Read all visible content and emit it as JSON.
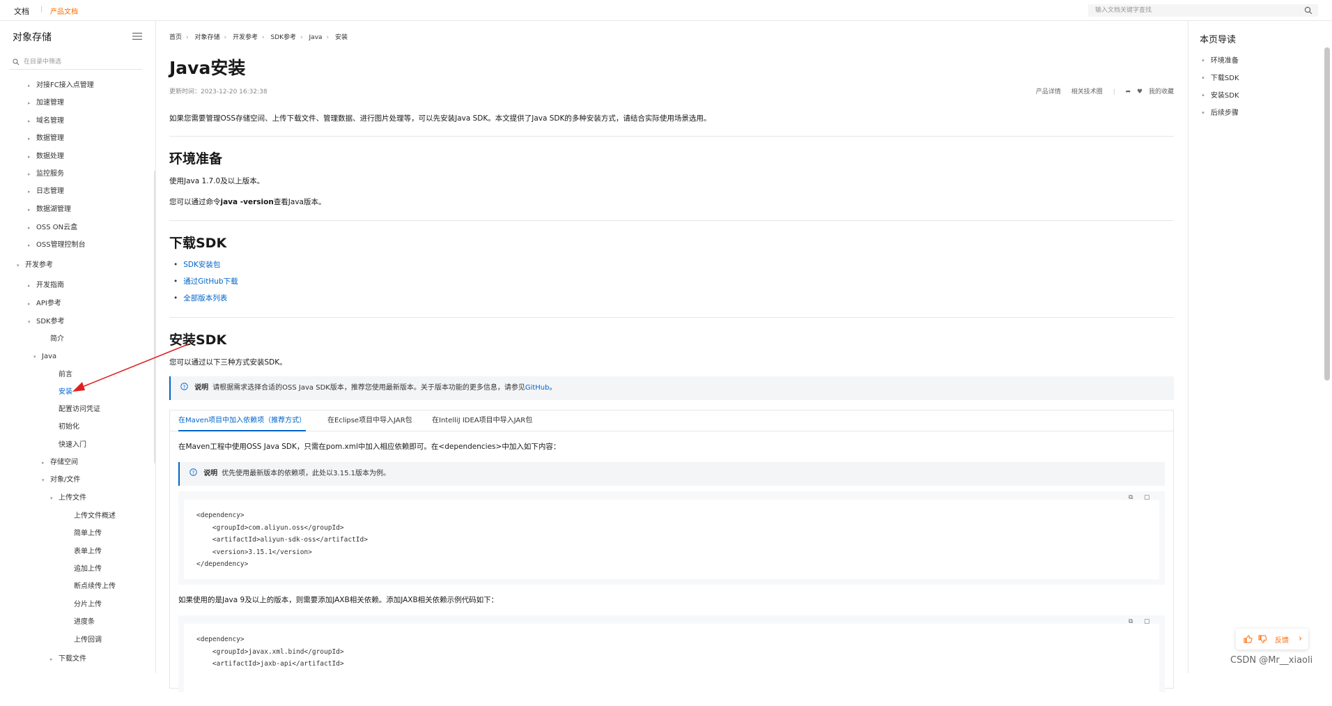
{
  "topbar": {
    "doc_label": "文档",
    "product_label": "产品文档",
    "search_placeholder": "输入文档关键字查找"
  },
  "sidebar": {
    "title": "对象存储",
    "filter_placeholder": "在目录中筛选",
    "items": [
      {
        "label": "对接FC接入点管理",
        "caret": "▸"
      },
      {
        "label": "加速管理",
        "caret": "▸"
      },
      {
        "label": "域名管理",
        "caret": "▸"
      },
      {
        "label": "数据管理",
        "caret": "▸"
      },
      {
        "label": "数据处理",
        "caret": "▸"
      },
      {
        "label": "监控服务",
        "caret": "▸"
      },
      {
        "label": "日志管理",
        "caret": "▸"
      },
      {
        "label": "数据湖管理",
        "caret": "▸"
      },
      {
        "label": "OSS ON云盒",
        "caret": "▸"
      },
      {
        "label": "OSS管理控制台",
        "caret": "▸"
      },
      {
        "label": "开发参考",
        "caret": "▾"
      },
      {
        "label": "开发指南",
        "caret": "▸"
      },
      {
        "label": "API参考",
        "caret": "▸"
      },
      {
        "label": "SDK参考",
        "caret": "▾"
      },
      {
        "label": "简介",
        "caret": ""
      },
      {
        "label": "Java",
        "caret": "▾"
      },
      {
        "label": "前言",
        "caret": ""
      },
      {
        "label": "安装",
        "caret": ""
      },
      {
        "label": "配置访问凭证",
        "caret": ""
      },
      {
        "label": "初始化",
        "caret": ""
      },
      {
        "label": "快速入门",
        "caret": ""
      },
      {
        "label": "存储空间",
        "caret": "▸"
      },
      {
        "label": "对象/文件",
        "caret": "▾"
      },
      {
        "label": "上传文件",
        "caret": "▾"
      },
      {
        "label": "上传文件概述",
        "caret": ""
      },
      {
        "label": "简单上传",
        "caret": ""
      },
      {
        "label": "表单上传",
        "caret": ""
      },
      {
        "label": "追加上传",
        "caret": ""
      },
      {
        "label": "断点续传上传",
        "caret": ""
      },
      {
        "label": "分片上传",
        "caret": ""
      },
      {
        "label": "进度条",
        "caret": ""
      },
      {
        "label": "上传回调",
        "caret": ""
      },
      {
        "label": "下载文件",
        "caret": "▸"
      }
    ]
  },
  "breadcrumb": [
    "首页",
    "对象存储",
    "开发参考",
    "SDK参考",
    "Java",
    "安装"
  ],
  "article": {
    "title": "Java安装",
    "updated": "更新时间：2023-12-20 16:32:38",
    "actions": [
      "产品详情",
      "相关技术圈",
      "我的收藏"
    ],
    "intro": "如果您需要管理OSS存储空间、上传下载文件、管理数据、进行图片处理等，可以先安装Java SDK。本文提供了Java SDK的多种安装方式，请结合实际使用场景选用。",
    "env_title": "环境准备",
    "env_p1": "使用Java 1.7.0及以上版本。",
    "env_p2_a": "您可以通过命令",
    "env_p2_b": "java -version",
    "env_p2_c": "查看Java版本。",
    "download_title": "下载SDK",
    "download_links": [
      "SDK安装包",
      "通过GitHub下载",
      "全部版本列表"
    ],
    "install_title": "安装SDK",
    "install_p": "您可以通过以下三种方式安装SDK。",
    "note1_label": "说明",
    "note1_text": "请根据需求选择合适的OSS Java SDK版本，推荐您使用最新版本。关于版本功能的更多信息，请参见",
    "note1_link": "GitHub",
    "note1_end": "。",
    "tabs": [
      "在Maven项目中加入依赖项（推荐方式）",
      "在Eclipse项目中导入JAR包",
      "在IntelliJ IDEA项目中导入JAR包"
    ],
    "maven_p": "在Maven工程中使用OSS Java SDK，只需在pom.xml中加入相应依赖即可。在<dependencies>中加入如下内容：",
    "note2_label": "说明",
    "note2_text": "优先使用最新版本的依赖项，此处以3.15.1版本为例。",
    "code1": "<dependency>\n    <groupId>com.aliyun.oss</groupId>\n    <artifactId>aliyun-sdk-oss</artifactId>\n    <version>3.15.1</version>\n</dependency>",
    "jaxb_p": "如果使用的是Java 9及以上的版本，则需要添加JAXB相关依赖。添加JAXB相关依赖示例代码如下：",
    "code2": "<dependency>\n    <groupId>javax.xml.bind</groupId>\n    <artifactId>jaxb-api</artifactId>"
  },
  "toc": {
    "title": "本页导读",
    "items": [
      "环境准备",
      "下载SDK",
      "安装SDK",
      "后续步骤"
    ]
  },
  "feedback": {
    "label": "反馈"
  },
  "watermark": "CSDN @Mr__xiaoli",
  "colors": {
    "link": "#0064c8",
    "brand": "#ff6a00",
    "annotation": "#e02020"
  }
}
